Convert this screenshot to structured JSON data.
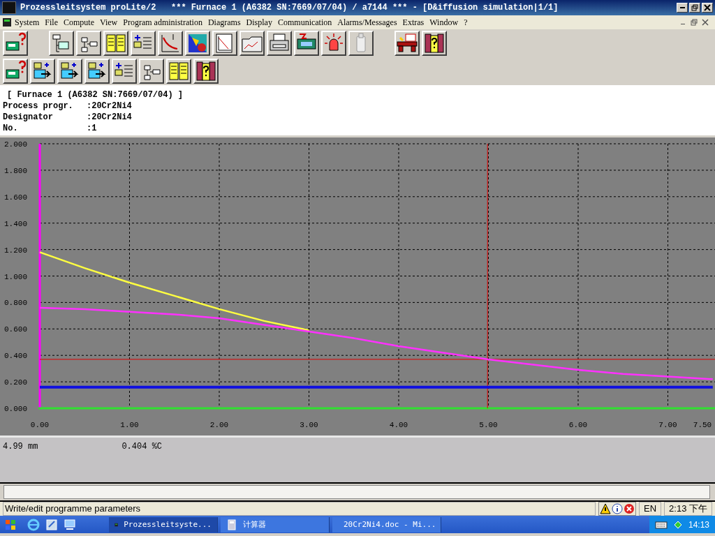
{
  "window": {
    "title": "Prozessleitsystem proLite/2   *** Furnace 1 (A6382 SN:7669/07/04) / a7144 *** - [D&iffusion simulation|1/1]"
  },
  "menu": [
    "System",
    "File",
    "Compute",
    "View",
    "Program administration",
    "Diagrams",
    "Display",
    "Communication",
    "Alarms/Messages",
    "Extras",
    "Window",
    "?"
  ],
  "info": {
    "heading": "[ Furnace 1 (A6382 SN:7669/07/04) ]",
    "fields": [
      {
        "label": "Process progr.",
        "value": ":20Cr2Ni4"
      },
      {
        "label": "Designator",
        "value": ":20Cr2Ni4"
      },
      {
        "label": "No.",
        "value": ":1"
      }
    ]
  },
  "chart_data": {
    "type": "line",
    "x": [
      0,
      0.5,
      1,
      1.5,
      2,
      2.5,
      3,
      3.5,
      4,
      4.5,
      5,
      5.5,
      6,
      6.5,
      7,
      7.5
    ],
    "xlim": [
      0,
      7.5
    ],
    "ylim": [
      0,
      2
    ],
    "xticks": [
      {
        "value": 0,
        "label": "0.00"
      },
      {
        "value": 1,
        "label": "1.00"
      },
      {
        "value": 2,
        "label": "2.00"
      },
      {
        "value": 3,
        "label": "3.00"
      },
      {
        "value": 4,
        "label": "4.00"
      },
      {
        "value": 5,
        "label": "5.00"
      },
      {
        "value": 6,
        "label": "6.00"
      },
      {
        "value": 7,
        "label": "7.00"
      },
      {
        "value": 7.5,
        "label": "7.50"
      }
    ],
    "yticks": [
      {
        "value": 0,
        "label": "0.000"
      },
      {
        "value": 0.2,
        "label": "0.200"
      },
      {
        "value": 0.4,
        "label": "0.400"
      },
      {
        "value": 0.6,
        "label": "0.600"
      },
      {
        "value": 0.8,
        "label": "0.800"
      },
      {
        "value": 1,
        "label": "1.000"
      },
      {
        "value": 1.2,
        "label": "1.200"
      },
      {
        "value": 1.4,
        "label": "1.400"
      },
      {
        "value": 1.6,
        "label": "1.600"
      },
      {
        "value": 1.8,
        "label": "1.800"
      },
      {
        "value": 2,
        "label": "2.000"
      }
    ],
    "series": [
      {
        "color": "#ffff40",
        "values": [
          1.18,
          1.06,
          0.95,
          0.85,
          0.75,
          0.66,
          0.59,
          null,
          null,
          null,
          null,
          null,
          null,
          null,
          null,
          null
        ]
      },
      {
        "color": "#ff30ff",
        "values": [
          0.76,
          0.75,
          0.73,
          0.71,
          0.68,
          0.63,
          0.58,
          0.53,
          0.47,
          0.42,
          0.37,
          0.33,
          0.29,
          0.26,
          0.24,
          0.22
        ]
      },
      {
        "color": "#1010e0",
        "values": [
          0.16,
          0.16,
          0.16,
          0.16,
          0.16,
          0.16,
          0.16,
          0.16,
          0.16,
          0.16,
          0.16,
          0.16,
          0.16,
          0.16,
          0.16,
          0.16
        ]
      }
    ],
    "grid": true,
    "ref_lines": [
      {
        "axis": "x",
        "value": 4.99,
        "color": "#e00000"
      },
      {
        "axis": "y",
        "value": 0.37,
        "color": "#e00000"
      }
    ]
  },
  "readout": {
    "position": "4.99 mm",
    "value": "0.404 %C"
  },
  "status_bar": {
    "text": "Write/edit programme parameters",
    "language": "EN",
    "time": "2:13 下午"
  },
  "taskbar": {
    "tasks": [
      {
        "label": "Prozessleitsyste...",
        "selected": true,
        "kind": "app"
      },
      {
        "label": "计算器",
        "selected": false,
        "kind": "calc"
      },
      {
        "label": "20Cr2Ni4.doc - Mi...",
        "selected": false,
        "kind": "doc"
      }
    ],
    "clock": "14:13"
  }
}
